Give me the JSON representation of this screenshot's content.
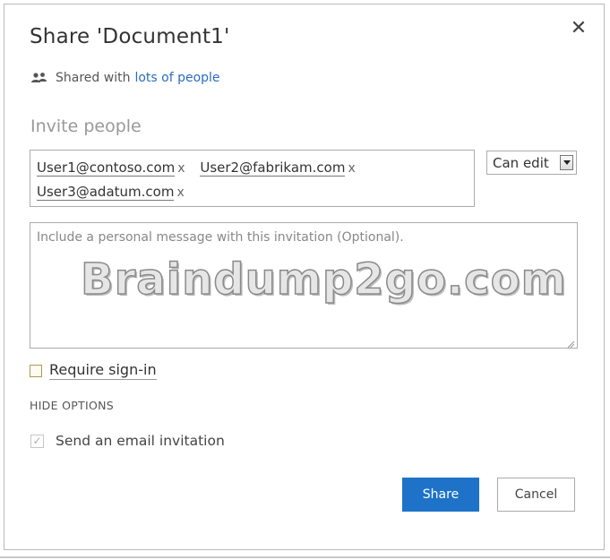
{
  "dialog": {
    "title": "Share 'Document1'",
    "close_glyph": "✕"
  },
  "shared_with": {
    "prefix": "Shared with",
    "link": "lots of people",
    "icon": "people-icon"
  },
  "invite": {
    "label": "Invite people",
    "recipients": [
      {
        "address": "User1@contoso.com",
        "remove": "x"
      },
      {
        "address": "User2@fabrikam.com",
        "remove": "x"
      },
      {
        "address": "User3@adatum.com",
        "remove": "x"
      }
    ],
    "permission": "Can edit",
    "dropdown_icon": "chevron-down-icon"
  },
  "message": {
    "placeholder": "Include a personal message with this invitation (Optional)."
  },
  "watermark": "Braindump2go.com",
  "options": {
    "require_signin_label": "Require sign-in",
    "require_signin_checked": false,
    "hide_options_label": "HIDE OPTIONS",
    "email_invite_label": "Send an email invitation",
    "email_invite_checked": true
  },
  "buttons": {
    "share": "Share",
    "cancel": "Cancel"
  },
  "colors": {
    "primary_button": "#1e73c8",
    "link": "#2a6cbf"
  }
}
